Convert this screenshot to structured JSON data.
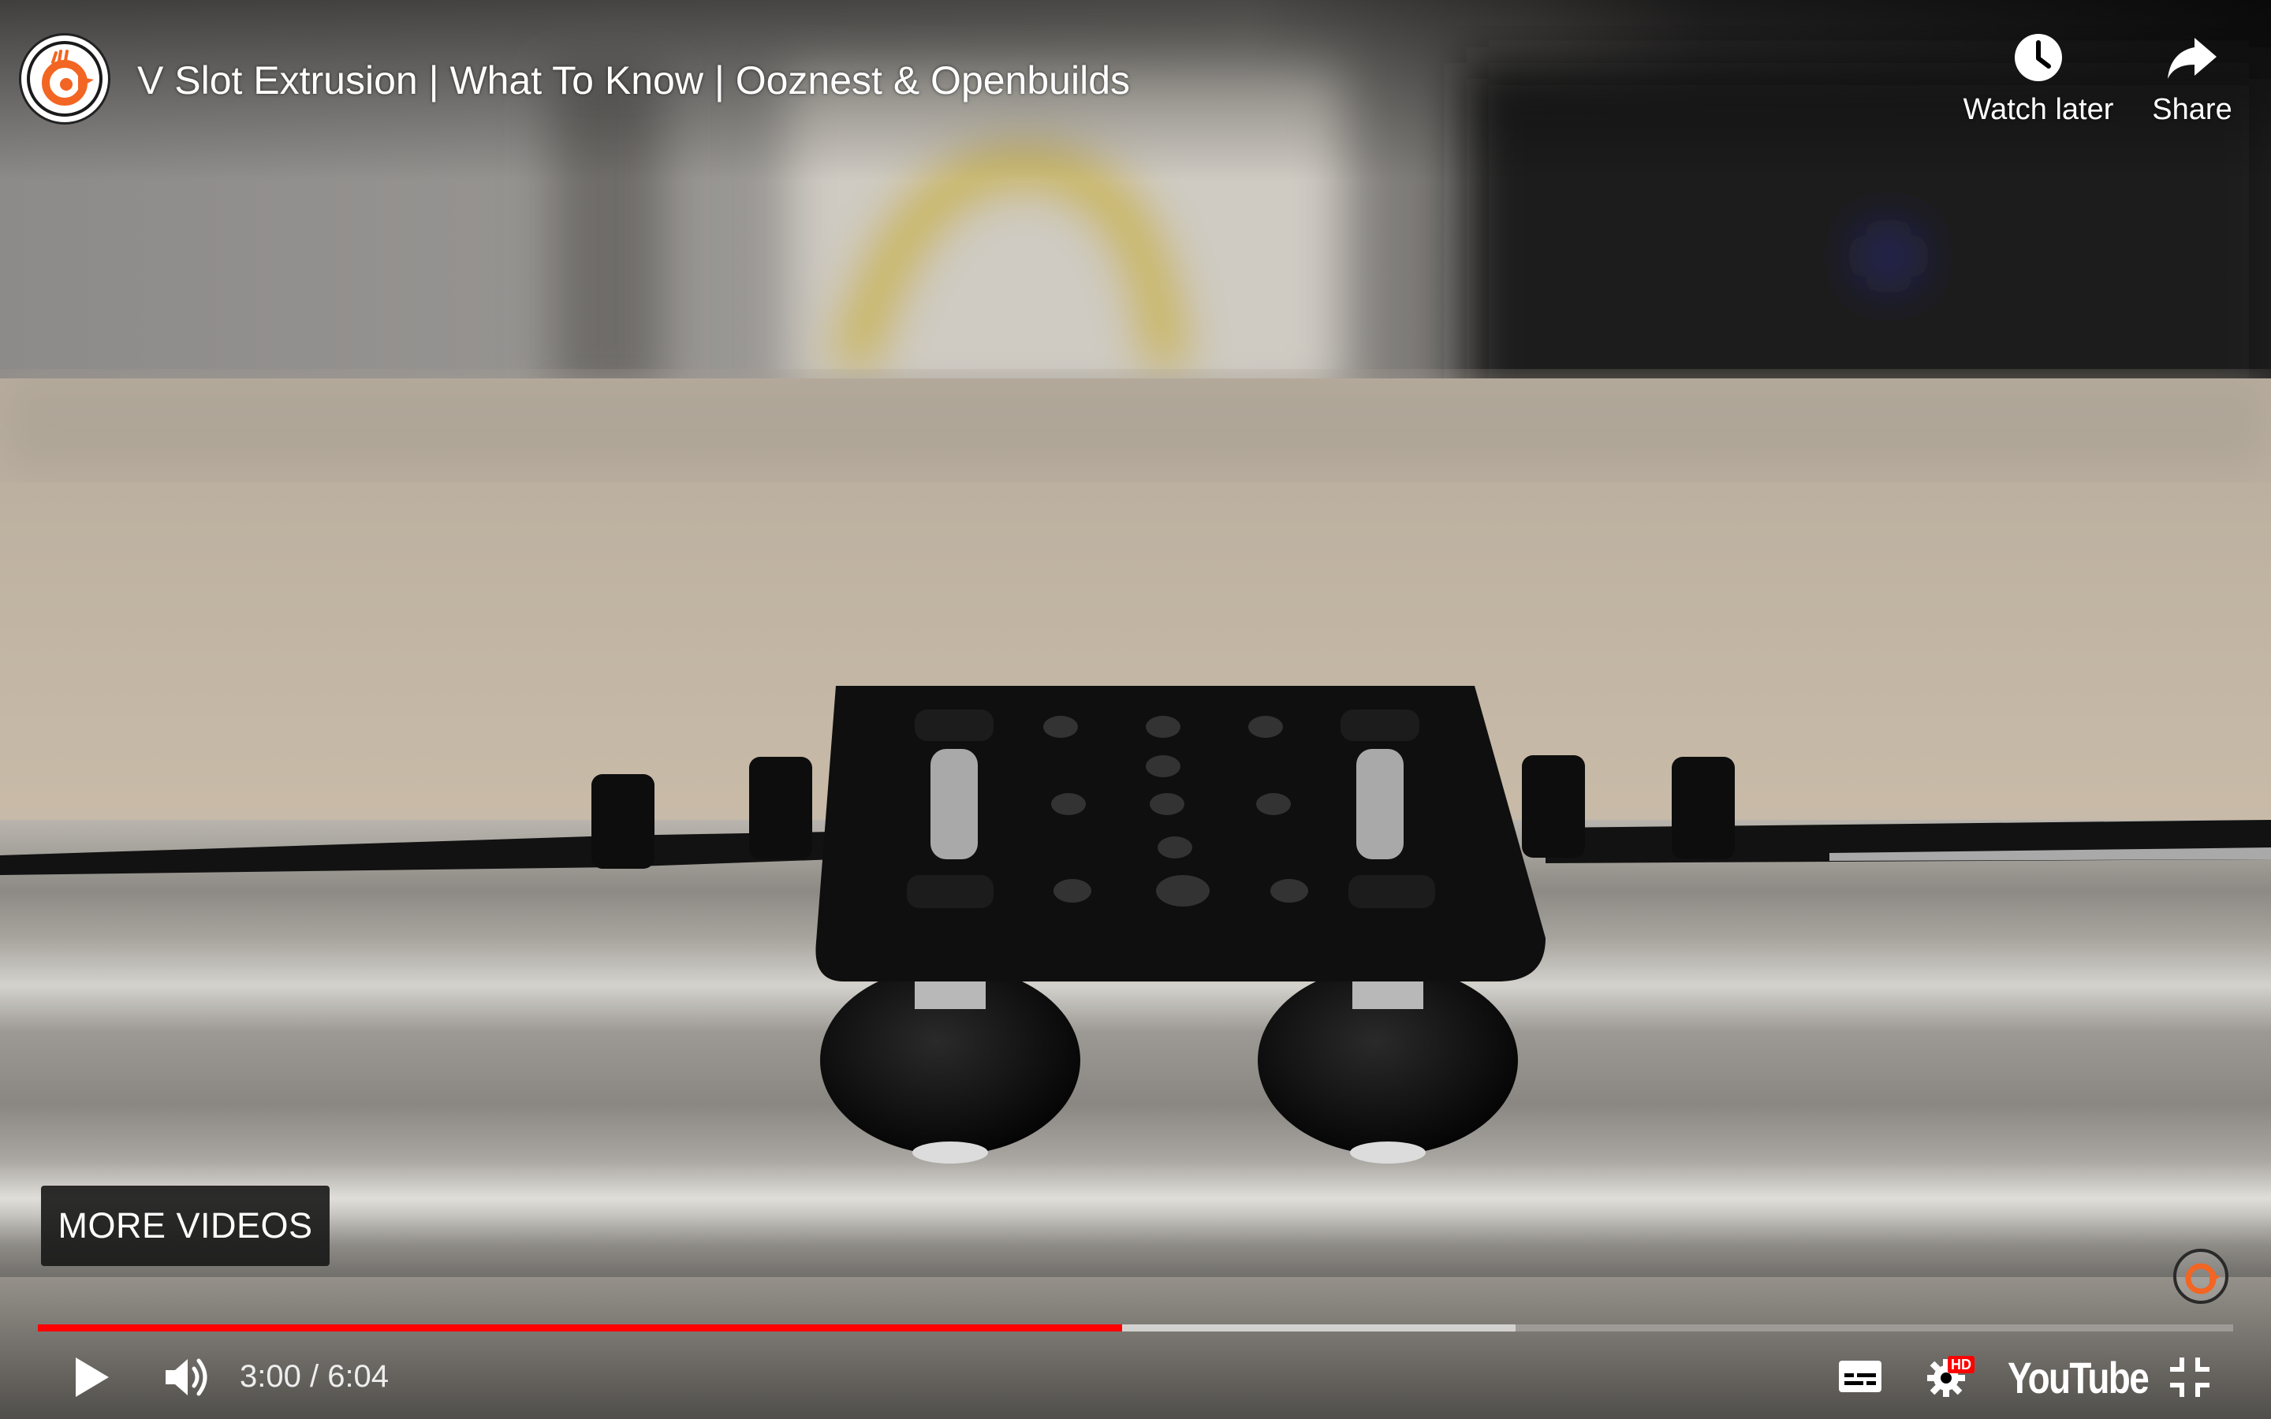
{
  "header": {
    "title": "V Slot Extrusion | What To Know | Ooznest & Openbuilds",
    "watch_later_label": "Watch later",
    "share_label": "Share"
  },
  "overlay": {
    "more_videos_label": "MORE VIDEOS"
  },
  "player": {
    "current_time": "3:00",
    "separator": " / ",
    "duration": "6:04",
    "time_text": "3:00 / 6:04",
    "played_fraction": 0.494,
    "buffered_fraction": 0.673,
    "hd_badge": "HD",
    "logo_text": "YouTube"
  },
  "icons": {
    "channel_avatar": "ooznest-logo",
    "watch_later": "clock-icon",
    "share": "share-arrow-icon",
    "play": "play-icon",
    "volume": "volume-icon",
    "subtitles": "subtitles-icon",
    "settings": "gear-icon",
    "exit_fullscreen": "exit-fullscreen-icon",
    "watermark": "ooznest-watermark"
  },
  "colors": {
    "accent": "#ff0000",
    "brand_orange": "#f26522",
    "more_videos_bg": "#171717"
  }
}
